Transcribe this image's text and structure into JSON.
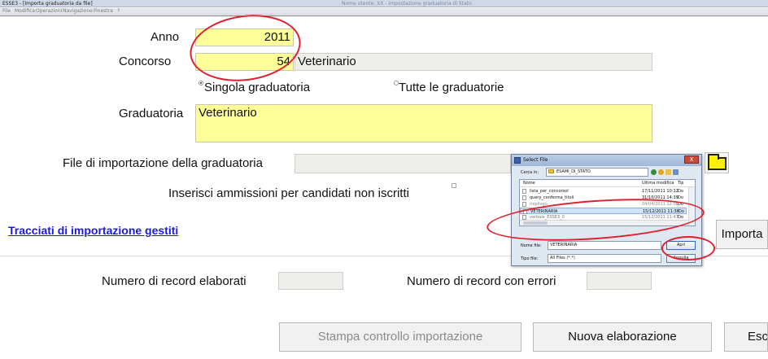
{
  "window": {
    "title": "ESSE3 - [Importa graduatoria da file]",
    "background_title": "Nome utente: XX - Impostazione graduatoria di Stato"
  },
  "menu": [
    "File",
    "Modifica",
    "Operazioni",
    "Navigazione",
    "Finestra",
    "?"
  ],
  "form": {
    "anno_label": "Anno",
    "anno_value": "2011",
    "concorso_label": "Concorso",
    "concorso_num": "54",
    "concorso_desc": "Veterinario",
    "radio_single_label": "Singola graduatoria",
    "radio_all_label": "Tutte le graduatorie",
    "radio_selected": "single",
    "graduatoria_label": "Graduatoria",
    "graduatoria_value": "Veterinario",
    "file_label": "File di importazione della graduatoria",
    "file_value": "",
    "inserisci_label": "Inserisci ammissioni per candidati non iscritti",
    "tracciati_link": "Tracciati di importazione gestiti",
    "importa_label": "Importa",
    "record_elaborati_label": "Numero di record elaborati",
    "record_elaborati_value": "",
    "record_errori_label": "Numero di record con errori",
    "record_errori_value": ""
  },
  "buttons": {
    "stampa": "Stampa controllo importazione",
    "nuova": "Nuova elaborazione",
    "esci": "Esci"
  },
  "dialog": {
    "title": "Select File",
    "close_glyph": "X",
    "look_in_label": "Cerca in:",
    "look_in_value": "ESAMI_DI_STATO",
    "columns": [
      "Nome",
      "Ultima modifica",
      "Tip"
    ],
    "files": [
      {
        "name": "lista_per_concorsoI",
        "date": "17/11/2011 10:12",
        "type": "Do"
      },
      {
        "name": "query_conferma_titoli",
        "date": "31/10/2011 14:39",
        "type": "Do"
      },
      {
        "name": "riepilogo",
        "date": "04/04/2011 12:06",
        "type": "Do"
      },
      {
        "name": "VETERINARIA",
        "date": "15/12/2011 11:36",
        "type": "Do"
      },
      {
        "name": "verbale_ESSE3_0",
        "date": "15/12/2011 11:47",
        "type": "Do"
      }
    ],
    "selected_index": 3,
    "filename_label": "Nome file:",
    "filename_value": "VETERINARIA",
    "filetype_label": "Tipo file:",
    "filetype_value": "All Files (*.*)",
    "open_label": "Apri",
    "cancel_label": "Annulla"
  },
  "colors": {
    "field_yellow": "#ffff9a",
    "annotation_red": "#e0202e",
    "link_blue": "#1a1adb"
  }
}
